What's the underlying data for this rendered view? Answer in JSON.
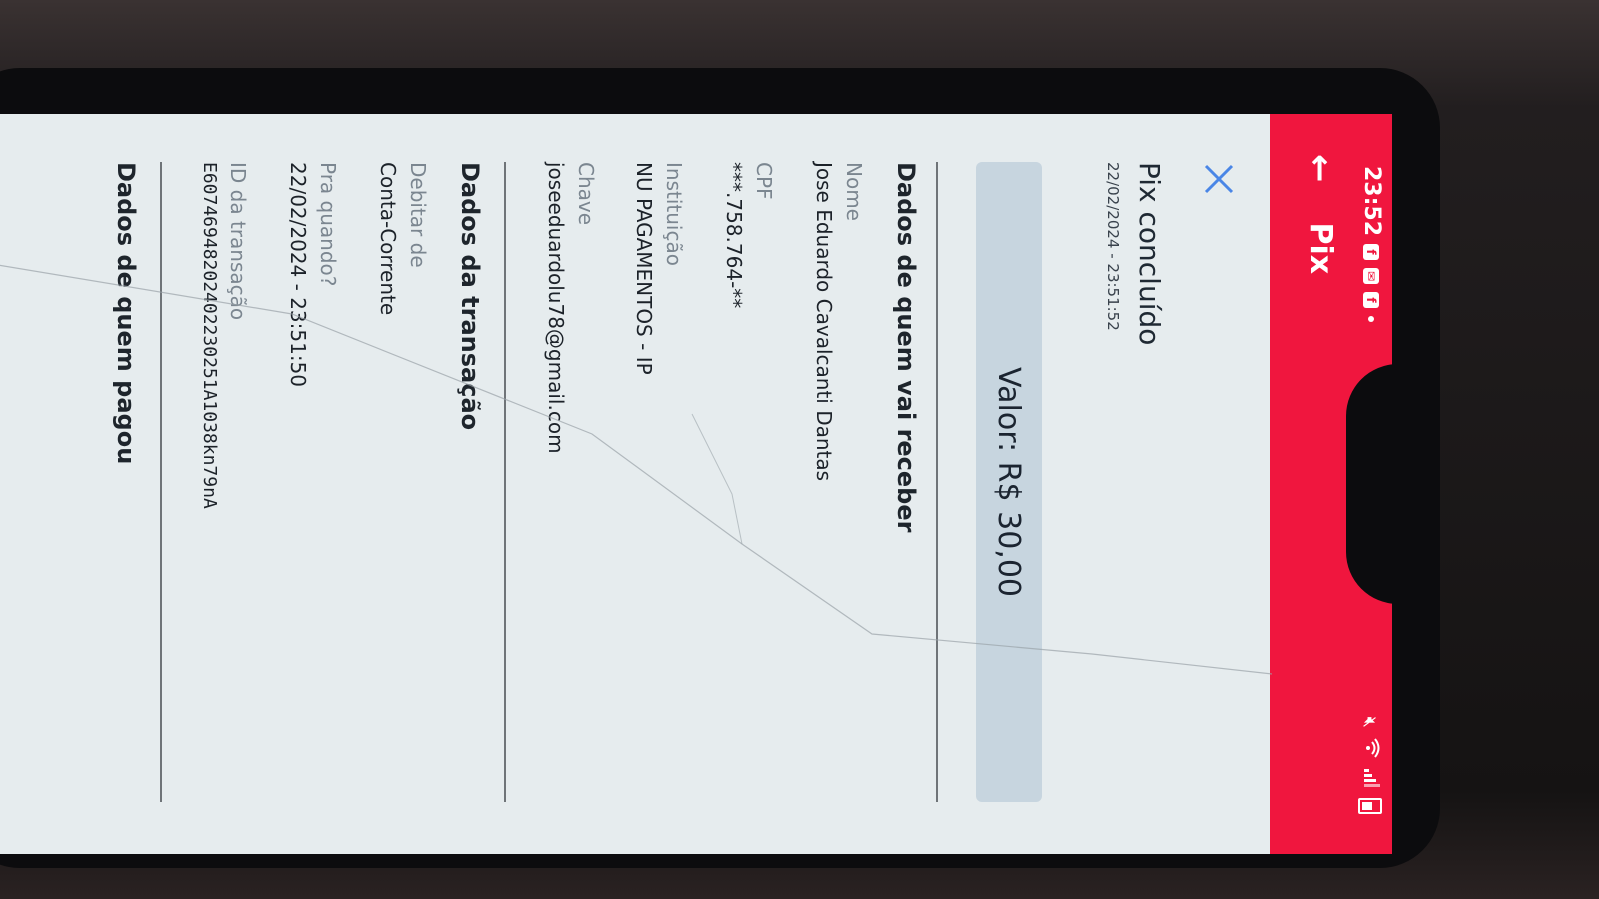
{
  "status_bar": {
    "time": "23:52",
    "notification_icons": [
      "facebook-icon",
      "message-icon",
      "facebook-icon"
    ],
    "right_icons": [
      "mute-icon",
      "wifi-icon",
      "signal-icon",
      "battery-icon"
    ]
  },
  "app_bar": {
    "back_icon": "arrow-left-icon",
    "title": "Pix"
  },
  "receipt": {
    "close_icon": "close-icon",
    "title": "Pix concluído",
    "datetime": "22/02/2024 - 23:51:52",
    "amount": "Valor: R$ 30,00"
  },
  "recipient": {
    "section_title": "Dados de quem vai receber",
    "name_label": "Nome",
    "name_value": "Jose Eduardo Cavalcanti Dantas",
    "cpf_label": "CPF",
    "cpf_value": "***.758.764-**",
    "institution_label": "Instituição",
    "institution_value": "NU PAGAMENTOS - IP",
    "key_label": "Chave",
    "key_value": "joseeduardolu78@gmail.com"
  },
  "transaction": {
    "section_title": "Dados da transação",
    "debit_label": "Debitar de",
    "debit_value": "Conta-Corrente",
    "when_label": "Pra quando?",
    "when_value": "22/02/2024 - 23:51:50",
    "id_label": "ID da transação",
    "id_value": "E60746948202402230251A1038kn79nA"
  },
  "payer": {
    "section_title": "Dados de quem pagou"
  },
  "colors": {
    "brand_red": "#f0163e",
    "accent_blue": "#4a86e6",
    "amount_box": "#c7d5df",
    "screen_bg": "#e6ecee"
  }
}
